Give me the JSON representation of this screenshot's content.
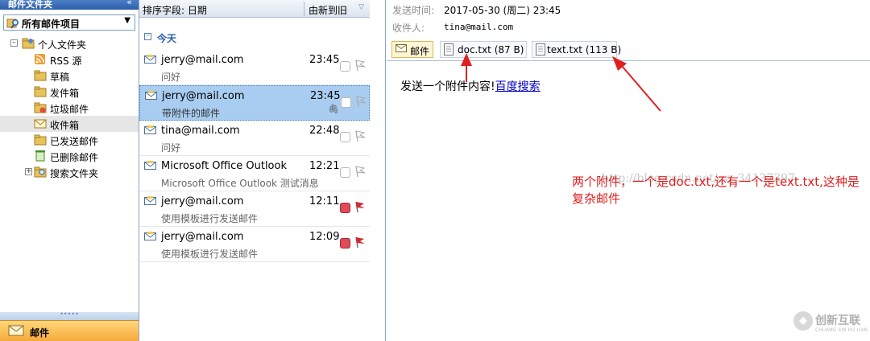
{
  "nav": {
    "header_title": "邮件文件夹",
    "collapse_glyph": "«",
    "favorites_label": "所有邮件项目",
    "tree": [
      {
        "label": "个人文件夹",
        "icon": "personal-folder-icon",
        "expand": "⊟"
      },
      {
        "label": "RSS 源",
        "icon": "rss-icon"
      },
      {
        "label": "草稿",
        "icon": "drafts-icon"
      },
      {
        "label": "发件箱",
        "icon": "outbox-icon"
      },
      {
        "label": "垃圾邮件",
        "icon": "junk-icon"
      },
      {
        "label": "收件箱",
        "icon": "inbox-icon",
        "selected": true
      },
      {
        "label": "已发送邮件",
        "icon": "sent-icon"
      },
      {
        "label": "已删除邮件",
        "icon": "deleted-icon"
      },
      {
        "label": "搜索文件夹",
        "icon": "search-folder-icon",
        "expand": "⊞"
      }
    ],
    "bottom_button": "邮件",
    "splitter_glyph": "•••••"
  },
  "list": {
    "sort_label": "排序字段: 日期",
    "order_label": "由新到旧",
    "group_label": "今天",
    "messages": [
      {
        "from": "jerry@mail.com",
        "time": "23:45",
        "subject": "问好",
        "flag": "none",
        "category": "none"
      },
      {
        "from": "jerry@mail.com",
        "time": "23:45",
        "subject": "带附件的邮件",
        "flag": "none",
        "category": "none",
        "selected": true,
        "attachment": true
      },
      {
        "from": "tina@mail.com",
        "time": "22:48",
        "subject": "问好",
        "flag": "none",
        "category": "none"
      },
      {
        "from": "Microsoft Office Outlook",
        "time": "12:21",
        "subject": "Microsoft Office Outlook 测试消息",
        "flag": "none",
        "category": "none"
      },
      {
        "from": "jerry@mail.com",
        "time": "12:11",
        "subject": "使用模板进行发送邮件",
        "flag": "red",
        "category": "red"
      },
      {
        "from": "jerry@mail.com",
        "time": "12:09",
        "subject": "使用模板进行发送邮件",
        "flag": "red",
        "category": "red"
      }
    ]
  },
  "reading": {
    "sent_key": "发送时间:",
    "sent_value": "2017-05-30 (周二) 23:45",
    "to_key": "收件人:",
    "to_value": "tina@mail.com",
    "attachments": [
      {
        "label": "邮件",
        "icon": "mail-icon"
      },
      {
        "label": "doc.txt (87 B)",
        "icon": "text-file-icon"
      },
      {
        "label": "text.txt (113 B)",
        "icon": "text-file-icon"
      }
    ],
    "body_text": "发送一个附件内容!",
    "body_link": "百度搜索",
    "watermark": "http://blog.csdn.net/qq_34137397",
    "annotation": "两个附件，一个是doc.txt,还有一个是text.txt,这种是复杂邮件",
    "logo_text": "创新互联",
    "logo_sub": "CHUANG XIN HU LIAN"
  },
  "colors": {
    "accent_blue": "#2d5fa9",
    "selection": "#a8cdf0",
    "annotation_red": "#e02020",
    "flag_red": "#e04b5a"
  }
}
